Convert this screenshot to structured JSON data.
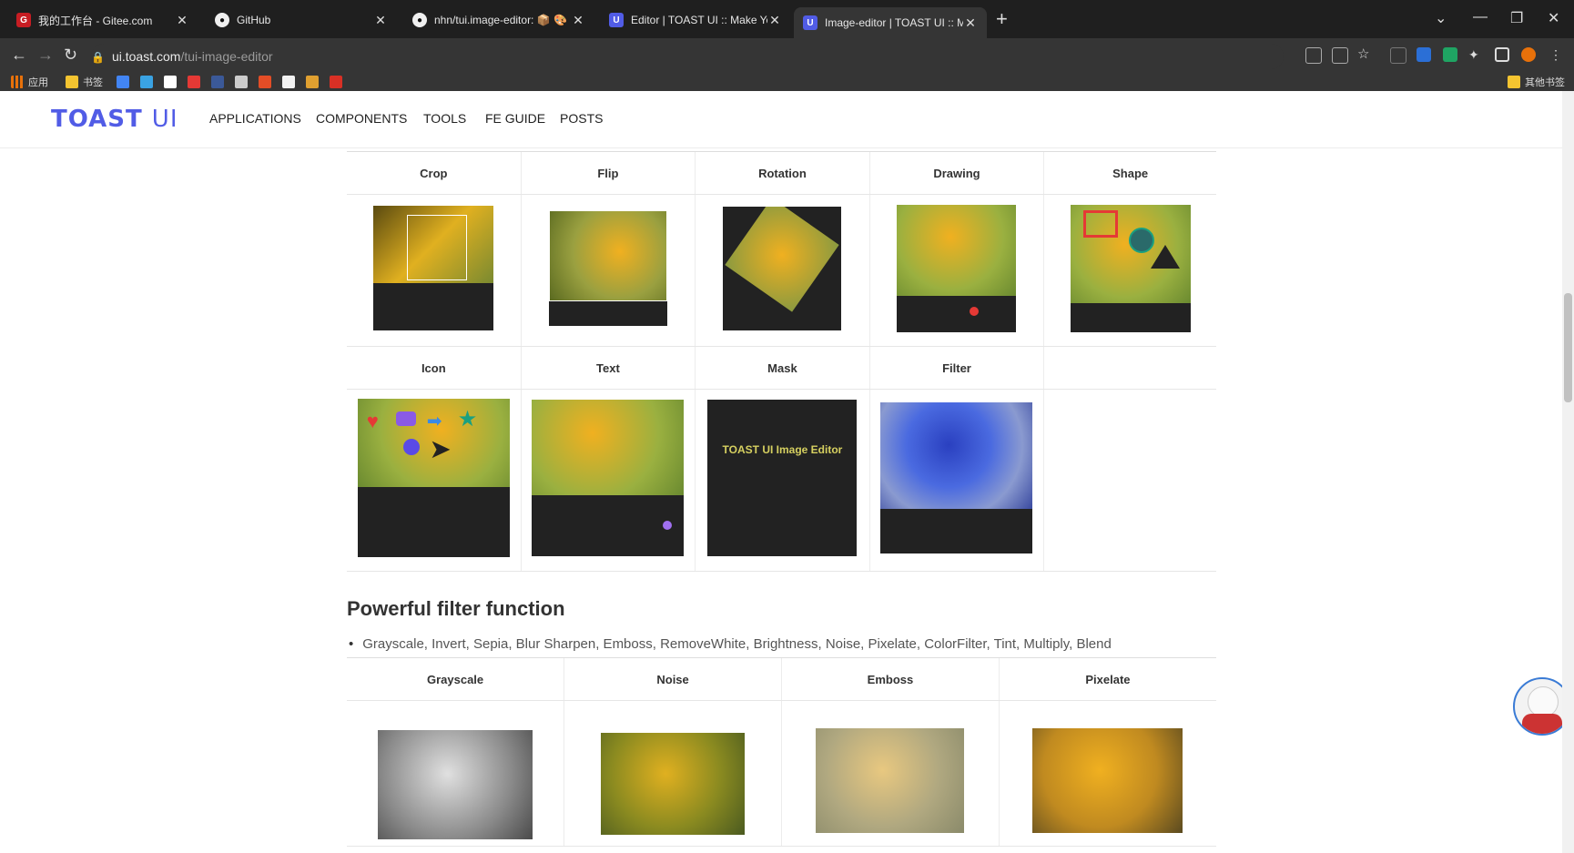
{
  "browser": {
    "tabs": [
      {
        "title": "我的工作台 - Gitee.com",
        "icon_color": "#c71d23",
        "icon": "gitee-icon"
      },
      {
        "title": "GitHub",
        "icon_color": "#1f1f1f",
        "icon": "github-icon"
      },
      {
        "title": "nhn/tui.image-editor: 📦 🎨 Fu",
        "icon_color": "#1f1f1f",
        "icon": "github-icon"
      },
      {
        "title": "Editor | TOAST UI :: Make Your",
        "icon_color": "#515ce6",
        "icon": "toast-ui-icon"
      },
      {
        "title": "Image-editor | TOAST UI :: Mak",
        "icon_color": "#515ce6",
        "icon": "toast-ui-icon"
      }
    ],
    "active_tab": 4,
    "url_host": "ui.toast.com",
    "url_path": "/tui-image-editor",
    "bookmarks": [
      {
        "label": "应用",
        "color": "#e8710a"
      },
      {
        "label": "书签",
        "color": "#f4c430"
      }
    ],
    "other_bookmarks": "其他书签",
    "bookmark_icon_colors": [
      "#4285f4",
      "#3aa3e3",
      "#ffffff",
      "#e53935",
      "#3b5998",
      "#cccccc",
      "#e44d26",
      "#f2f2f2",
      "#e0a030",
      "#d93025"
    ]
  },
  "site": {
    "logo_main": "TOAST",
    "logo_ui": "UI",
    "nav": [
      "APPLICATIONS",
      "COMPONENTS",
      "TOOLS",
      "FE GUIDE",
      "POSTS"
    ]
  },
  "features_row1": [
    "Crop",
    "Flip",
    "Rotation",
    "Drawing",
    "Shape"
  ],
  "features_row2": [
    "Icon",
    "Text",
    "Mask",
    "Filter",
    ""
  ],
  "mask_caption": "TOAST UI Image Editor",
  "filter_section": {
    "title": "Powerful filter function",
    "bullet": "Grayscale, Invert, Sepia, Blur Sharpen, Emboss, RemoveWhite, Brightness, Noise, Pixelate, ColorFilter, Tint, Multiply, Blend",
    "columns": [
      "Grayscale",
      "Noise",
      "Emboss",
      "Pixelate"
    ]
  },
  "colors": {
    "brand": "#515ce6",
    "chrome_dark": "#1f1f1f",
    "chrome_mid": "#353535"
  }
}
